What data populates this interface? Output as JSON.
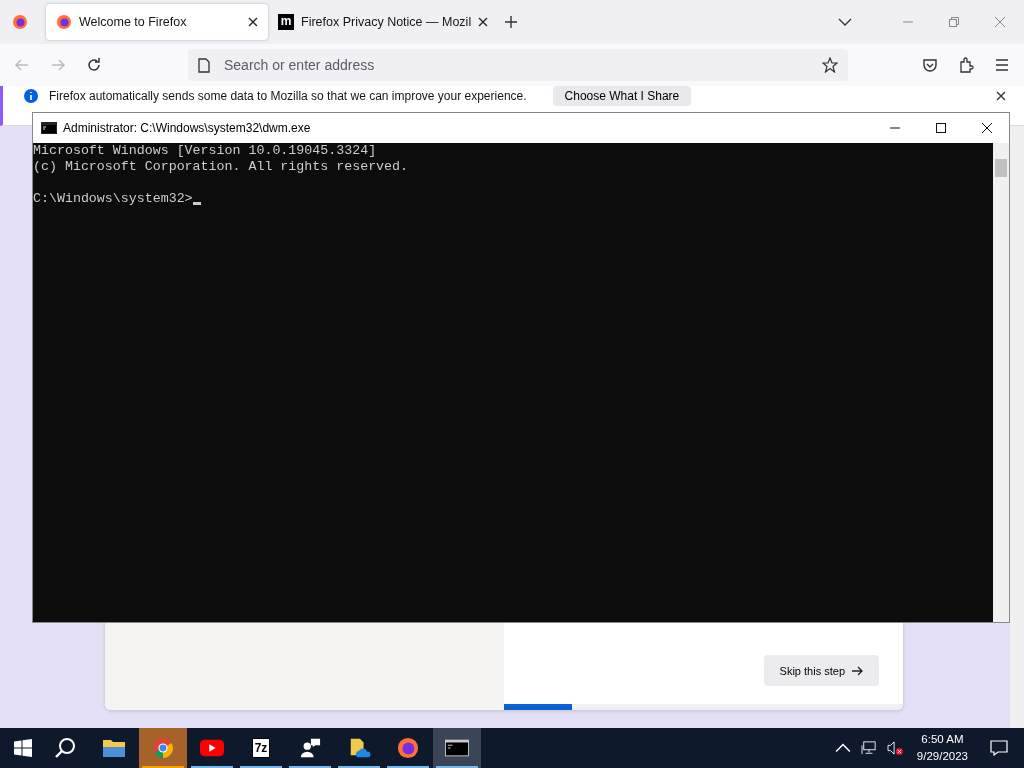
{
  "browser": {
    "tabs": [
      {
        "title": "Welcome to Firefox",
        "kind": "firefox",
        "selected": true
      },
      {
        "title": "Firefox Privacy Notice — Mozil",
        "kind": "mozilla",
        "icon_text": "m",
        "selected": false
      }
    ],
    "address": {
      "placeholder": "Search or enter address"
    },
    "notification": {
      "text": "Firefox automatically sends some data to Mozilla so that we can improve your experience.",
      "button": "Choose What I Share"
    },
    "page": {
      "skip_button": "Skip this step",
      "progress": {
        "level": 0.17
      }
    }
  },
  "console": {
    "title": "Administrator: C:\\Windows\\system32\\dwm.exe",
    "lines": [
      "Microsoft Windows [Version 10.0.19045.3324]",
      "(c) Microsoft Corporation. All rights reserved."
    ],
    "prompt": "C:\\Windows\\system32>"
  },
  "taskbar": {
    "apps": [
      {
        "kind": "explorer",
        "running": false,
        "focused": false,
        "attention": false
      },
      {
        "kind": "chrome",
        "running": true,
        "focused": false,
        "attention": true
      },
      {
        "kind": "youtube",
        "running": true,
        "focused": false,
        "attention": false
      },
      {
        "kind": "sevenzip",
        "icon_text": "7z",
        "running": true,
        "focused": false,
        "attention": false
      },
      {
        "kind": "people",
        "running": true,
        "focused": false,
        "attention": false
      },
      {
        "kind": "onedrive",
        "running": true,
        "focused": false,
        "attention": false
      },
      {
        "kind": "firefox",
        "running": true,
        "focused": false,
        "attention": false
      },
      {
        "kind": "console",
        "running": true,
        "focused": true,
        "attention": false
      }
    ],
    "time": "6:50 AM",
    "date": "9/29/2023"
  }
}
